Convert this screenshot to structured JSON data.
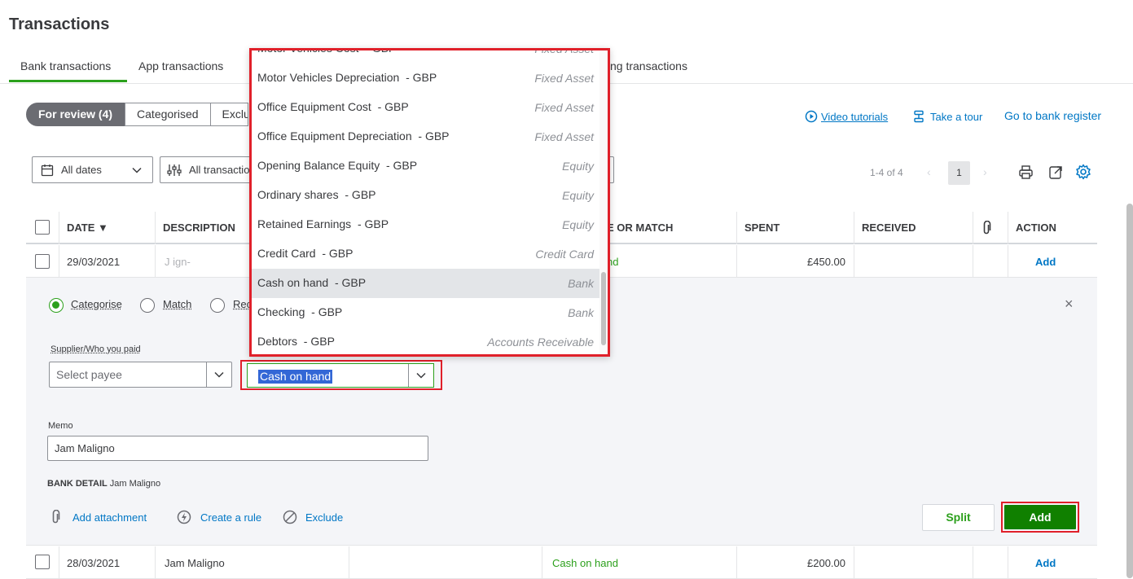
{
  "page": {
    "title": "Transactions"
  },
  "tabs": [
    {
      "label": "Bank transactions"
    },
    {
      "label": "App transactions"
    },
    {
      "label": "ng transactions"
    }
  ],
  "review_tabs": {
    "for_review": "For review (4)",
    "categorised": "Categorised",
    "excluded": "Excluded"
  },
  "links": {
    "video": "Video tutorials",
    "tour": "Take a tour",
    "register": "Go to bank register"
  },
  "filters": {
    "dates": "All dates",
    "transactions": "All transactions"
  },
  "pager": {
    "range": "1-4 of 4",
    "page": "1"
  },
  "columns": {
    "date": "DATE ▼",
    "description": "DESCRIPTION",
    "categorise": "E OR MATCH",
    "spent": "SPENT",
    "received": "RECEIVED",
    "action": "ACTION"
  },
  "rows": [
    {
      "date": "29/03/2021",
      "description": "J        ign-",
      "category": "nd",
      "spent": "£450.00",
      "received": "",
      "action": "Add"
    },
    {
      "date": "28/03/2021",
      "description": "Jam Maligno",
      "category": "Cash on hand",
      "spent": "£200.00",
      "received": "",
      "action": "Add"
    }
  ],
  "panel": {
    "radio_categorise": "Categorise",
    "radio_match": "Match",
    "radio_record": "Rec",
    "payee_label": "Supplier/Who you paid",
    "payee_placeholder": "Select payee",
    "category_value": "Cash on hand",
    "memo_label": "Memo",
    "memo_value": "Jam Maligno",
    "bank_detail_label": "BANK DETAIL",
    "bank_detail_value": "Jam Maligno",
    "add_attachment": "Add attachment",
    "create_rule": "Create a rule",
    "exclude": "Exclude",
    "split": "Split",
    "add": "Add",
    "close": "×"
  },
  "dropdown": {
    "options": [
      {
        "name": "Motor Vehicles Cost  - GBP",
        "type": "Fixed Asset"
      },
      {
        "name": "Motor Vehicles Depreciation  - GBP",
        "type": "Fixed Asset"
      },
      {
        "name": "Office Equipment Cost  - GBP",
        "type": "Fixed Asset"
      },
      {
        "name": "Office Equipment Depreciation  - GBP",
        "type": "Fixed Asset"
      },
      {
        "name": "Opening Balance Equity  - GBP",
        "type": "Equity"
      },
      {
        "name": "Ordinary shares  - GBP",
        "type": "Equity"
      },
      {
        "name": "Retained Earnings  - GBP",
        "type": "Equity"
      },
      {
        "name": "Credit Card  - GBP",
        "type": "Credit Card"
      },
      {
        "name": "Cash on hand  - GBP",
        "type": "Bank"
      },
      {
        "name": "Checking  - GBP",
        "type": "Bank"
      },
      {
        "name": "Debtors  - GBP",
        "type": "Accounts Receivable"
      }
    ]
  },
  "colors": {
    "accent": "#2ca01c",
    "link": "#0077c5",
    "highlight": "#e0202a",
    "add_button": "#108000"
  }
}
